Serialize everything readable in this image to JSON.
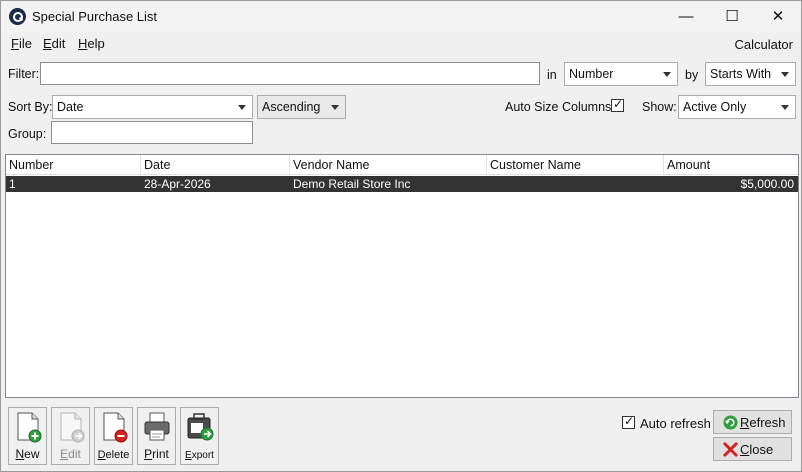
{
  "window": {
    "title": "Special Purchase List",
    "controls": {
      "minimize": "—",
      "maximize": "☐",
      "close": "✕"
    }
  },
  "menu": {
    "file": {
      "key": "F",
      "rest": "ile"
    },
    "edit": {
      "key": "E",
      "rest": "dit"
    },
    "help": {
      "key": "H",
      "rest": "elp"
    },
    "calculator": "Calculator"
  },
  "filter": {
    "label": "Filter:",
    "value": "",
    "in_label": "in",
    "in_value": "Number",
    "by_label": "by",
    "by_value": "Starts With"
  },
  "sort": {
    "label": "Sort By:",
    "field": "Date",
    "direction": "Ascending",
    "auto_size_label": "Auto Size Columns",
    "auto_size_checked": true,
    "show_label": "Show:",
    "show_value": "Active Only"
  },
  "group": {
    "label": "Group:",
    "value": ""
  },
  "table": {
    "columns": [
      "Number",
      "Date",
      "Vendor Name",
      "Customer Name",
      "Amount"
    ],
    "rows": [
      {
        "number": "1",
        "date": "28-Apr-2026",
        "vendor": "Demo Retail Store Inc",
        "customer": "",
        "amount": "$5,000.00",
        "selected": true
      }
    ]
  },
  "toolbar": {
    "new": {
      "key": "N",
      "rest": "ew",
      "icon": "new-document-icon",
      "enabled": true
    },
    "edit": {
      "key": "E",
      "rest": "dit",
      "icon": "edit-document-icon",
      "enabled": false
    },
    "delete": {
      "key": "D",
      "rest": "elete",
      "icon": "delete-document-icon",
      "enabled": true
    },
    "print": {
      "key": "P",
      "rest": "rint",
      "icon": "printer-icon",
      "enabled": true
    },
    "export": {
      "key": "E",
      "rest": "xport",
      "icon": "export-icon",
      "enabled": true
    }
  },
  "footer": {
    "auto_refresh_label": "Auto refresh",
    "auto_refresh_checked": true,
    "refresh": {
      "key": "R",
      "rest": "efresh",
      "icon": "refresh-icon"
    },
    "close": {
      "key": "C",
      "rest": "lose",
      "icon": "close-x-icon"
    }
  },
  "colors": {
    "selected_row": "#333333",
    "new_icon": "#2e9e3e",
    "delete_icon": "#d62020",
    "close_icon": "#d62020",
    "refresh_icon": "#2e9e3e"
  }
}
